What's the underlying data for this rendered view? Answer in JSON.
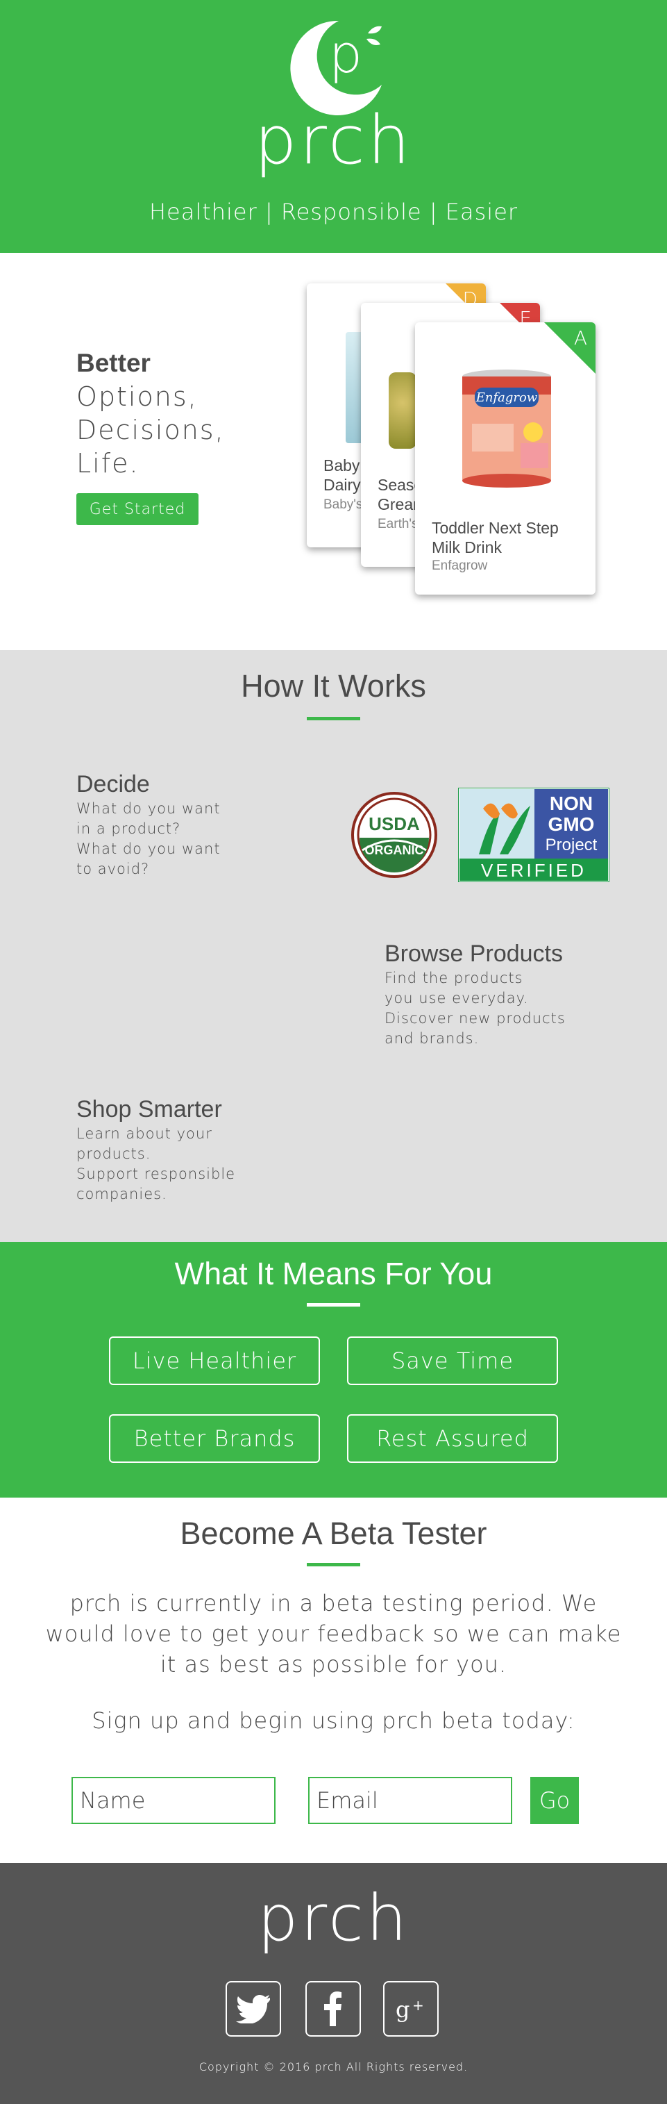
{
  "hero": {
    "logo_letter": "p",
    "logo_word": "prch",
    "tagline": "Healthier | Responsible | Easier"
  },
  "intro": {
    "better": "Better",
    "words": [
      "Options,",
      "Decisions,",
      "Life."
    ],
    "cta": "Get Started",
    "cards": [
      {
        "grade": "D",
        "name": "Baby\nDairy",
        "brand": "Baby's",
        "grade_color": "#f0b13a"
      },
      {
        "grade": "E",
        "name": "Seaso\nGrean",
        "brand": "Earth's",
        "grade_color": "#d9413c"
      },
      {
        "grade": "A",
        "name": "Toddler Next Step\nMilk Drink",
        "brand": "Enfagrow",
        "grade_color": "#3db84a"
      }
    ],
    "can_label": "Enfagrow"
  },
  "how": {
    "title": "How It Works",
    "steps": [
      {
        "title": "Decide",
        "body": "What do you want\nin a product?\nWhat do you want\nto avoid?"
      },
      {
        "title": "Browse Products",
        "body": "Find the products\nyou use everyday.\nDiscover new products\nand brands."
      },
      {
        "title": "Shop Smarter",
        "body": "Learn about your\nproducts.\nSupport responsible\ncompanies."
      }
    ],
    "usda": {
      "line1": "USDA",
      "line2": "ORGANIC"
    },
    "nongmo": {
      "line1": "NON",
      "line2": "GMO",
      "line3": "Project",
      "line4": "VERIFIED"
    }
  },
  "means": {
    "title": "What It Means For You",
    "items": [
      "Live Healthier",
      "Save Time",
      "Better Brands",
      "Rest Assured"
    ]
  },
  "beta": {
    "title": "Become A Beta Tester",
    "text": "prch is currently in a beta testing period. We would love to get your feedback so we can make it as best as possible for you.",
    "signup": "Sign up and begin using prch beta today:",
    "name_placeholder": "Name",
    "email_placeholder": "Email",
    "go": "Go"
  },
  "footer": {
    "logo": "prch",
    "social": [
      "twitter-icon",
      "facebook-icon",
      "google-plus-icon"
    ],
    "copyright": "Copyright © 2016 prch All Rights reserved."
  },
  "colors": {
    "green": "#3db84a",
    "grey_bg": "#e0e0e0",
    "footer_bg": "#555555",
    "text": "#4a4a4a"
  }
}
